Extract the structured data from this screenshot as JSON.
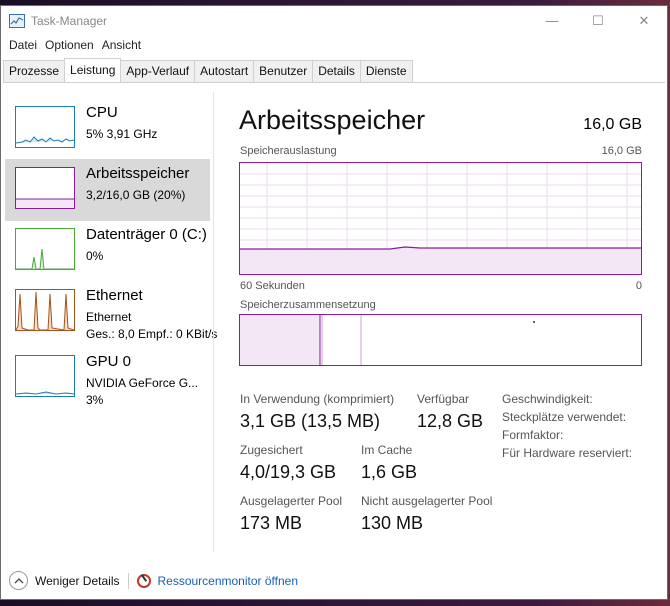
{
  "window": {
    "title": "Task-Manager",
    "minimize_glyph": "—",
    "maximize_glyph": "☐",
    "close_glyph": "✕"
  },
  "menu": [
    "Datei",
    "Optionen",
    "Ansicht"
  ],
  "tabs": [
    "Prozesse",
    "Leistung",
    "App-Verlauf",
    "Autostart",
    "Benutzer",
    "Details",
    "Dienste"
  ],
  "active_tab": "Leistung",
  "sidebar": {
    "cpu": {
      "name": "CPU",
      "line2": "5% 3,91 GHz",
      "color": "#1f7ab8"
    },
    "memory": {
      "name": "Arbeitsspeicher",
      "line2": "3,2/16,0 GB (20%)",
      "color": "#8b1aa0"
    },
    "disk": {
      "name": "Datenträger 0 (C:)",
      "line2": "0%",
      "color": "#4aa83a"
    },
    "ethernet": {
      "name": "Ethernet",
      "line2": "Ethernet",
      "line3": "Ges.: 8,0  Empf.: 0 KBit/s",
      "color": "#a7531b"
    },
    "gpu": {
      "name": "GPU 0",
      "line2": "NVIDIA GeForce G...",
      "line3": "3%",
      "color": "#1f7ab8"
    }
  },
  "main": {
    "title": "Arbeitsspeicher",
    "total": "16,0 GB",
    "usage_label": "Speicherauslastung",
    "usage_max": "16,0 GB",
    "time_left": "60 Sekunden",
    "time_right": "0",
    "composition_label": "Speicherzusammensetzung",
    "usage_fraction": 0.2,
    "stats": {
      "in_use_label": "In Verwendung (komprimiert)",
      "in_use_value": "3,1 GB (13,5 MB)",
      "available_label": "Verfügbar",
      "available_value": "12,8 GB",
      "committed_label": "Zugesichert",
      "committed_value": "4,0/19,3 GB",
      "cached_label": "Im Cache",
      "cached_value": "1,6 GB",
      "paged_label": "Ausgelagerter Pool",
      "paged_value": "173 MB",
      "nonpaged_label": "Nicht ausgelagerter Pool",
      "nonpaged_value": "130 MB"
    },
    "right_labels": [
      "Geschwindigkeit:",
      "Steckplätze verwendet:",
      "Formfaktor:",
      "Für Hardware reserviert:"
    ]
  },
  "footer": {
    "less_details": "Weniger Details",
    "resource_monitor": "Ressourcenmonitor öffnen"
  }
}
